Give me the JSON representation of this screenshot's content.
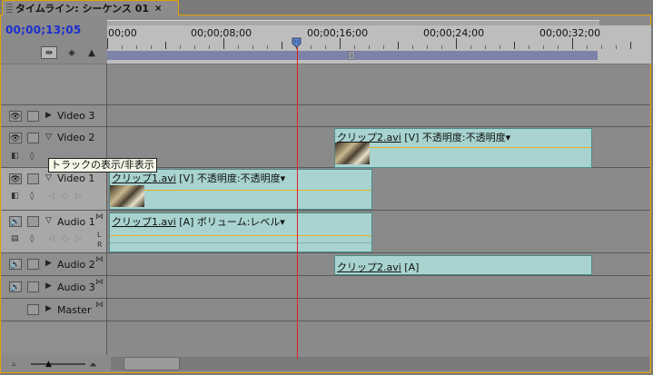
{
  "panel": {
    "title": "タイムライン: シーケンス 01",
    "close": "×"
  },
  "timecode": "00;00;13;05",
  "ruler": {
    "labels": [
      "00;00",
      "00;00;08;00",
      "00;00;16;00",
      "00;00;24;00",
      "00;00;32;00"
    ]
  },
  "tooltip": "トラックの表示/非表示",
  "tracks": {
    "video3": {
      "name": "Video 3"
    },
    "video2": {
      "name": "Video 2"
    },
    "video1": {
      "name": "Video 1"
    },
    "audio1": {
      "name": "Audio 1"
    },
    "audio2": {
      "name": "Audio 2"
    },
    "audio3": {
      "name": "Audio 3"
    },
    "master": {
      "name": "Master"
    }
  },
  "clips": {
    "v2": {
      "file": "クリップ2.avi",
      "rest": " [V] 不透明度:不透明度▾"
    },
    "v1": {
      "file": "クリップ1.avi",
      "rest": " [V] 不透明度:不透明度▾"
    },
    "a1": {
      "file": "クリップ1.avi",
      "rest": " [A] ボリューム:レベル▾"
    },
    "a2": {
      "file": "クリップ2.avi",
      "rest": " [A]"
    }
  },
  "icons": {
    "eye": "eye-icon",
    "speaker": "speaker-icon",
    "expand": "triangle-icon"
  }
}
